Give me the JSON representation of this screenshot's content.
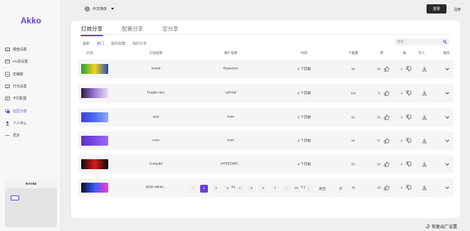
{
  "app": {
    "logo": "Akko"
  },
  "sidebar": {
    "items": [
      {
        "label": "键盘设置",
        "icon": "keyboard-icon"
      },
      {
        "label": "FN层设置",
        "icon": "fn-layer-icon"
      },
      {
        "label": "宏编辑",
        "icon": "macro-icon"
      },
      {
        "label": "灯光设置",
        "icon": "light-icon"
      },
      {
        "label": "不同配置",
        "icon": "profile-icon"
      },
      {
        "label": "社区分享",
        "icon": "community-icon",
        "active": true
      },
      {
        "label": "个人中心",
        "icon": "user-icon"
      },
      {
        "label": "更多",
        "icon": "more-icon"
      }
    ],
    "device": {
      "name": "RAY68"
    }
  },
  "topbar": {
    "language": "中文简体",
    "login": "登录",
    "register": "注册"
  },
  "tabs": [
    {
      "label": "灯效分享",
      "active": true
    },
    {
      "label": "配置分享"
    },
    {
      "label": "宏分享"
    }
  ],
  "filters": [
    {
      "label": "最新"
    },
    {
      "label": "热门",
      "selected": true
    },
    {
      "label": "我的收藏"
    },
    {
      "label": "我的分享"
    }
  ],
  "search": {
    "placeholder": "搜索"
  },
  "table": {
    "headers": [
      "灯效",
      "灯效名称",
      "用户名称",
      "时间",
      "下载量",
      "赞",
      "踩",
      "写入",
      "操作"
    ],
    "rows": [
      {
        "name": "brasil",
        "user": "Ryanzero",
        "time": "4 个月前",
        "downloads": "68",
        "likes": "95",
        "dislikes": "0",
        "colors": [
          "#1ea33b",
          "#f4d21d",
          "#1f4fb3"
        ]
      },
      {
        "name": "Purple Hex",
        "user": "LilFr0d",
        "time": "4 个月前",
        "downloads": "164",
        "likes": "72",
        "dislikes": "0",
        "colors": [
          "#2d1a44",
          "#9d7ad8",
          "#e6e0f5"
        ]
      },
      {
        "name": "azul",
        "user": "honi",
        "time": "3 个月前",
        "downloads": "63",
        "likes": "63",
        "dislikes": "0",
        "colors": [
          "#3b3fd8",
          "#4f6cf0",
          "#8fa8ff"
        ]
      },
      {
        "name": "roxo",
        "user": "honi",
        "time": "3 个月前",
        "downloads": "66",
        "likes": "57",
        "dislikes": "0",
        "colors": [
          "#5b2fc8",
          "#7d4ae6",
          "#9b6cf5"
        ]
      },
      {
        "name": "Coração",
        "user": "PPEEDDR...",
        "time": "4 个月前",
        "downloads": "63",
        "likes": "50",
        "dislikes": "0",
        "colors": [
          "#0a0a0a",
          "#d81b1b",
          "#0a0a0a"
        ]
      },
      {
        "name": "DGR MINH...",
        "user": "dgr42",
        "time": "2 个月前",
        "downloads": "48",
        "likes": "43",
        "dislikes": "0",
        "colors": [
          "#0b0b2a",
          "#3a5bff",
          "#ff3ad0"
        ]
      }
    ]
  },
  "pagination": {
    "prev": "‹",
    "pages": [
      "1",
      "2",
      "3",
      "4",
      "5",
      "6",
      "7",
      "...",
      "20"
    ],
    "next": "›",
    "jump_label": "跳至",
    "jump_suffix": "页",
    "current": "1"
  },
  "footer": {
    "reset": "恢复出厂设置"
  }
}
